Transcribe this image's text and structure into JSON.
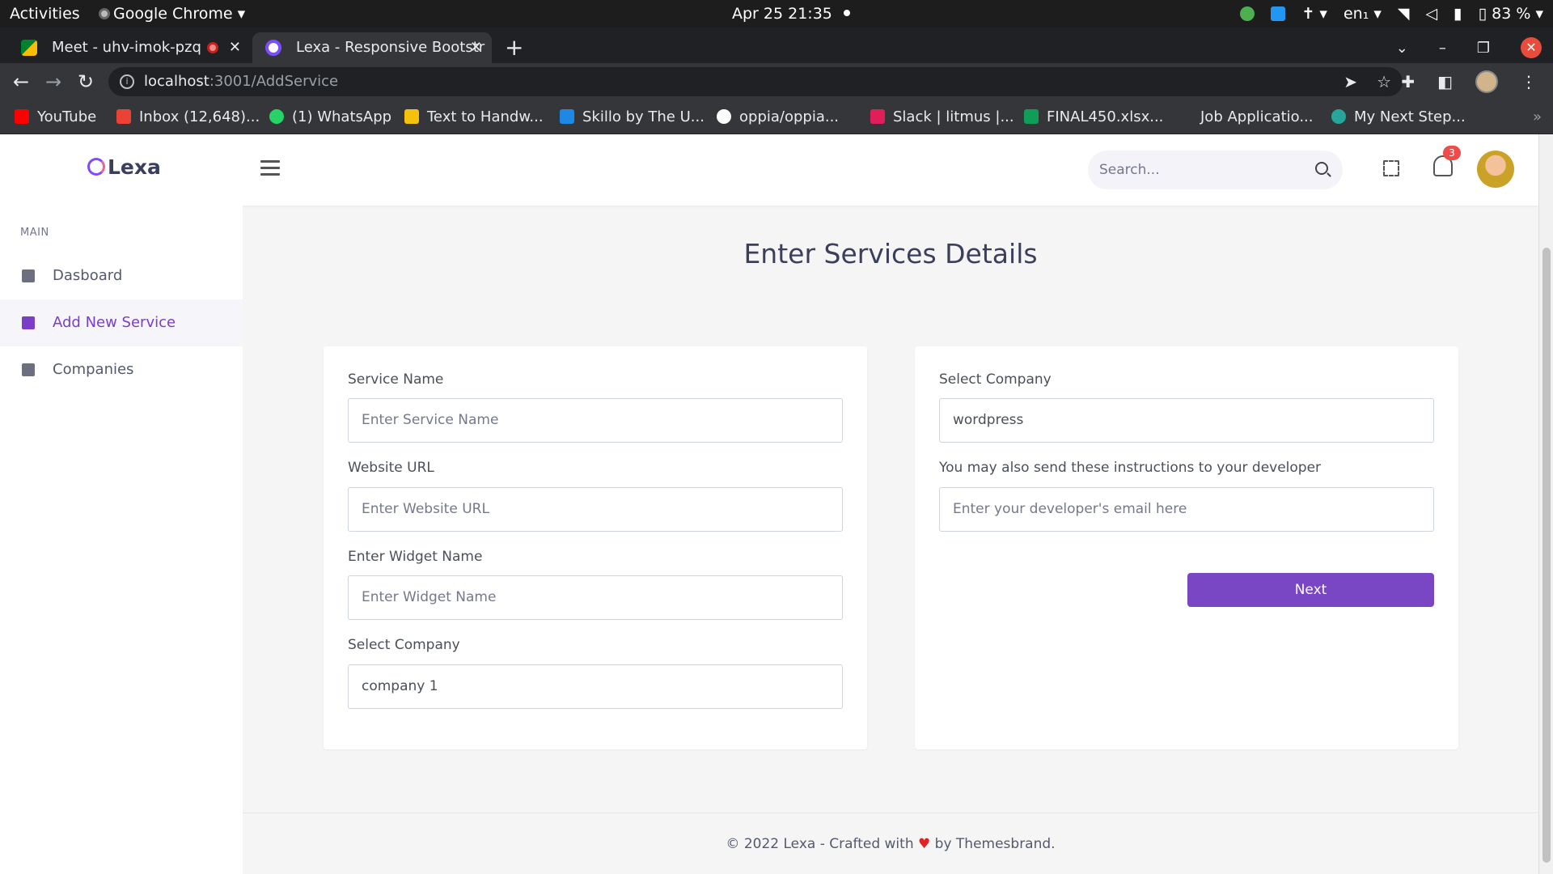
{
  "system": {
    "activities": "Activities",
    "app_name": "Google Chrome",
    "clock": "Apr 25  21:35",
    "lang": "en₁",
    "battery": "83 %"
  },
  "browser": {
    "tabs": [
      {
        "title": "Meet - uhv-imok-pzq"
      },
      {
        "title": "Lexa - Responsive Bootstr"
      }
    ],
    "url_host": "localhost",
    "url_path": ":3001/AddService",
    "bookmarks": [
      {
        "label": "YouTube",
        "color": "#ff0000"
      },
      {
        "label": "Inbox (12,648)...",
        "color": "#ea4335"
      },
      {
        "label": "(1) WhatsApp",
        "color": "#25d366"
      },
      {
        "label": "Text to Handw...",
        "color": "#f4c20d"
      },
      {
        "label": "Skillo by The U...",
        "color": "#1e88e5"
      },
      {
        "label": "oppia/oppia...",
        "color": "#ffffff"
      },
      {
        "label": "Slack | litmus |...",
        "color": "#e01e5a"
      },
      {
        "label": "FINAL450.xlsx...",
        "color": "#0f9d58"
      },
      {
        "label": "Job Applicatio...",
        "color": "#35363a"
      },
      {
        "label": "My Next Step...",
        "color": "#26a69a"
      }
    ]
  },
  "app": {
    "brand": "Lexa",
    "search_placeholder": "Search...",
    "notification_count": "3",
    "sidebar": {
      "section_title": "MAIN",
      "items": [
        {
          "label": "Dasboard",
          "icon": "dashboard-icon"
        },
        {
          "label": "Add New Service",
          "icon": "file-icon"
        },
        {
          "label": "Companies",
          "icon": "building-icon"
        }
      ]
    },
    "page_title": "Enter Services Details",
    "left_form": {
      "service_name_label": "Service Name",
      "service_name_placeholder": "Enter Service Name",
      "website_url_label": "Website URL",
      "website_url_placeholder": "Enter Website URL",
      "widget_name_label": "Enter Widget Name",
      "widget_name_placeholder": "Enter Widget Name",
      "company_label": "Select Company",
      "company_value": "company 1"
    },
    "right_form": {
      "company_label": "Select Company",
      "company_value": "wordpress",
      "developer_label": "You may also send these instructions to your developer",
      "developer_placeholder": "Enter your developer's email here",
      "next_label": "Next"
    },
    "footer": {
      "prefix": "© 2022 Lexa - Crafted with ",
      "heart": "♥",
      "suffix": " by Themesbrand."
    },
    "accent_color": "#7a47c4"
  }
}
